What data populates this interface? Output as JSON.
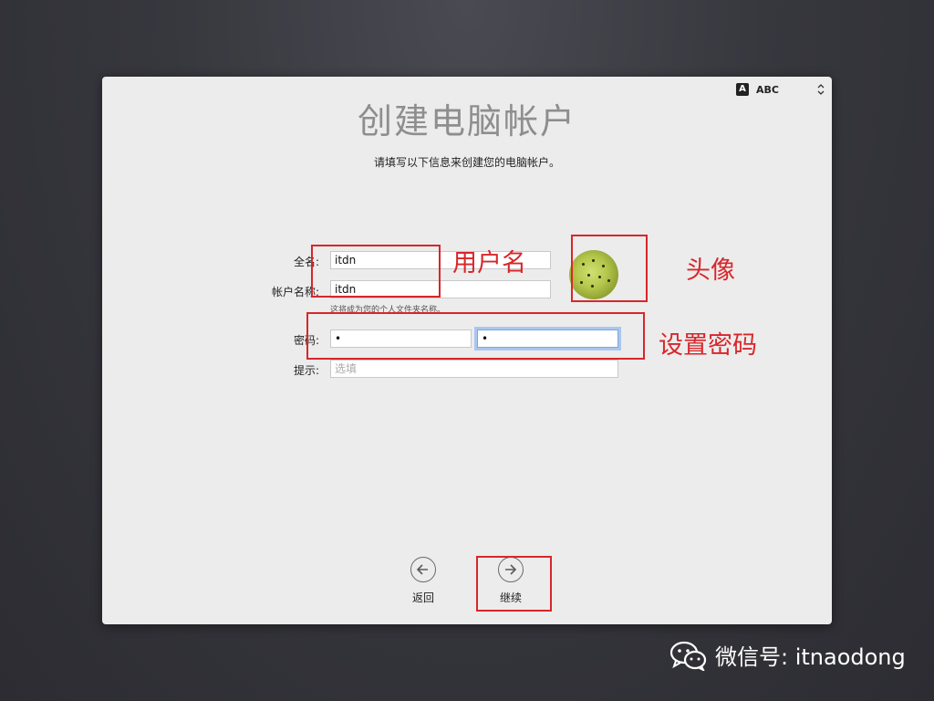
{
  "window": {
    "title": "创建电脑帐户",
    "subtitle": "请填写以下信息来创建您的电脑帐户。"
  },
  "input_menu": {
    "icon_letter": "A",
    "label": "ABC",
    "arrows": "⌃⌄"
  },
  "form": {
    "full_name_label": "全名:",
    "full_name_value": "itdn",
    "account_name_label": "帐户名称:",
    "account_name_value": "itdn",
    "account_name_hint": "这将成为您的个人文件夹名称。",
    "password_label": "密码:",
    "password_value": "•",
    "verify_value": "•",
    "hint_label": "提示:",
    "hint_placeholder": "选填"
  },
  "buttons": {
    "back_label": "返回",
    "continue_label": "继续"
  },
  "annotations": {
    "username": "用户名",
    "avatar": "头像",
    "password": "设置密码",
    "color": "#d8262a"
  },
  "watermark": {
    "text": "微信号: itnaodong"
  }
}
